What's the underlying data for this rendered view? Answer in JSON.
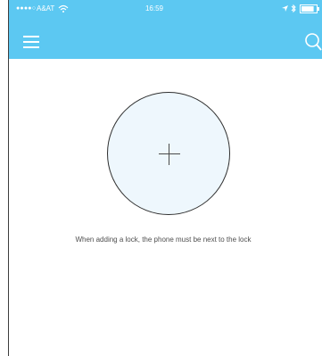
{
  "status_bar": {
    "signal": "●●●●○",
    "carrier": "A&AT",
    "time": "16:59",
    "wifi_icon": "wifi-icon",
    "location_icon": "location-arrow-icon",
    "bluetooth_icon": "bluetooth-icon",
    "battery_icon": "battery-icon",
    "battery_level_fraction": 0.85
  },
  "header": {
    "menu_icon": "hamburger-menu-icon",
    "search_icon": "search-icon"
  },
  "main": {
    "add_lock_icon": "plus-icon",
    "instruction": "When adding a lock, the phone must be next to the lock"
  },
  "colors": {
    "header_background": "#5cc8f2",
    "circle_fill": "#eef7fd",
    "circle_border": "#2f2f2f",
    "text": "#4f4f4f"
  }
}
